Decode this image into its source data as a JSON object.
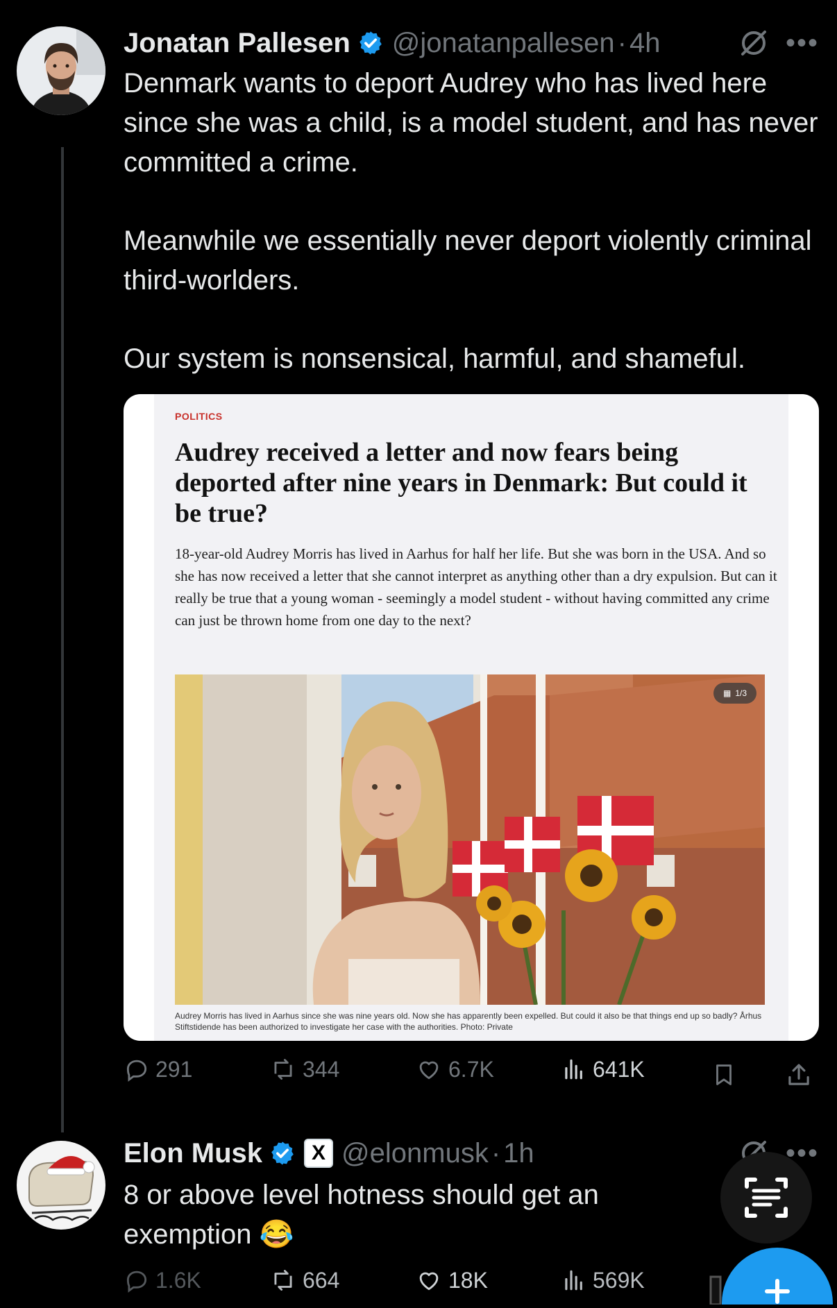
{
  "tweet1": {
    "author": {
      "name": "Jonatan Pallesen",
      "handle": "@jonatanpallesen",
      "sep": "·",
      "time": "4h"
    },
    "paragraphs": [
      "Denmark wants to deport Audrey who has lived here since she was a child, is a model student, and has never committed a crime.",
      "Meanwhile we essentially never deport violently criminal third-worlders.",
      "Our system is nonsensical, harmful, and shameful."
    ],
    "article": {
      "kicker": "POLITICS",
      "headline": "Audrey received a letter and now fears being deported after nine years in Denmark: But could it be true?",
      "deck": "18-year-old Audrey Morris has lived in Aarhus for half her life. But she was born in the USA. And so she has now received a letter that she cannot interpret as anything other than a dry expulsion. But can it really be true that a young woman - seemingly a model student - without having committed any crime can just be thrown home from one day to the next?",
      "photo_counter": "1/3",
      "caption": "Audrey Morris has lived in Aarhus since she was nine years old. Now she has apparently been expelled. But could it also be that things end up so badly? Århus Stiftstidende has been authorized to investigate her case with the authorities. Photo: Private"
    },
    "stats": {
      "replies": "291",
      "reposts": "344",
      "likes": "6.7K",
      "views": "641K"
    }
  },
  "tweet2": {
    "author": {
      "name": "Elon Musk",
      "handle": "@elonmusk",
      "sep": "·",
      "time": "1h",
      "badge": "X"
    },
    "text": "8 or above level hotness should get an exemption",
    "emoji": "😂",
    "stats": {
      "replies": "1.6K",
      "reposts": "664",
      "likes": "18K",
      "views": "569K"
    }
  },
  "icons": [
    "reply-icon",
    "repost-icon",
    "like-icon",
    "views-icon",
    "bookmark-icon",
    "share-icon",
    "grok-icon",
    "more-icon",
    "verified-icon",
    "text-recognition-icon",
    "compose-icon"
  ],
  "colors": {
    "background": "#000000",
    "text": "#e7e9ea",
    "muted": "#71767b",
    "verified": "#1d9bf0",
    "kicker": "#c8302a"
  }
}
